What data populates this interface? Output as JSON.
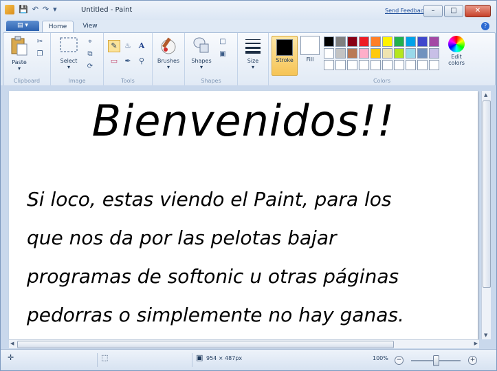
{
  "window": {
    "title": "Untitled - Paint",
    "feedback_link": "Send Feedback",
    "minimize": "–",
    "maximize": "□",
    "close": "✕"
  },
  "tabs": [
    "Home",
    "View"
  ],
  "ribbon": {
    "paste_label": "Paste",
    "select_label": "Select",
    "brushes_label": "Brushes",
    "shapes_label": "Shapes",
    "size_label": "Size",
    "stroke_label": "Stroke",
    "fill_label": "Fill",
    "edit_colors_line1": "Edit",
    "edit_colors_line2": "colors",
    "group_clipboard": "Clipboard",
    "group_image": "Image",
    "group_tools": "Tools",
    "group_shapes": "Shapes",
    "group_colors": "Colors",
    "text_tool_glyph": "A",
    "palette_row1": [
      "#000000",
      "#7f7f7f",
      "#880015",
      "#ed1c24",
      "#ff7f27",
      "#fff200",
      "#22b14c",
      "#00a2e8",
      "#3f48cc",
      "#a349a4"
    ],
    "palette_row2": [
      "#ffffff",
      "#c3c3c3",
      "#b97a57",
      "#ffaec9",
      "#ffc90e",
      "#efe4b0",
      "#b5e61d",
      "#99d9ea",
      "#7092be",
      "#c8bfe7"
    ],
    "palette_row3": [
      "#ffffff",
      "#ffffff",
      "#ffffff",
      "#ffffff",
      "#ffffff",
      "#ffffff",
      "#ffffff",
      "#ffffff",
      "#ffffff",
      "#ffffff"
    ]
  },
  "canvas": {
    "heading": "Bienvenidos!!",
    "lines": [
      "Si loco, estas viendo el Paint, para los",
      "que nos da por las pelotas bajar",
      "programas de softonic u otras páginas",
      "pedorras o simplemente no hay ganas."
    ]
  },
  "status": {
    "dimensions": "954 × 487px",
    "zoom": "100%",
    "zoom_fraction": 0.5
  }
}
